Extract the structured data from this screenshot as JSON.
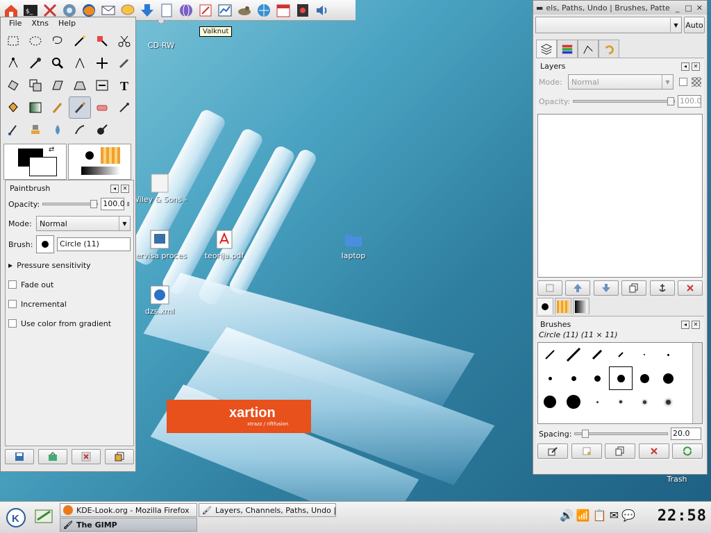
{
  "tooltip": "Valknut",
  "desktop_icons": [
    {
      "label": "CD-RW",
      "icon": "cdrom-icon"
    },
    {
      "label": "Wiley & Sons - The Art of So…",
      "icon": "document-icon"
    },
    {
      "label": "servisa procesu bloks…",
      "icon": "image-icon"
    },
    {
      "label": "teorija.pdf",
      "icon": "pdf-icon"
    },
    {
      "label": "laptop",
      "icon": "folder-icon"
    },
    {
      "label": "dzs.xml",
      "icon": "web-icon"
    },
    {
      "label": "Trash",
      "icon": "trash-icon"
    }
  ],
  "wallpaper": {
    "brand": "xartion",
    "sub": "xtrazz / riftfusion"
  },
  "toolbox": {
    "menu": [
      "File",
      "Xtns",
      "Help"
    ],
    "options_title": "Paintbrush",
    "opacity_label": "Opacity:",
    "opacity_value": "100.0",
    "mode_label": "Mode:",
    "mode_value": "Normal",
    "brush_label": "Brush:",
    "brush_value": "Circle (11)",
    "pressure_label": "Pressure sensitivity",
    "fade_label": "Fade out",
    "incremental_label": "Incremental",
    "gradient_label": "Use color from gradient"
  },
  "dock": {
    "title": "els, Paths, Undo | Brushes, Patte",
    "auto_label": "Auto",
    "layers_title": "Layers",
    "layers_mode_label": "Mode:",
    "layers_mode_value": "Normal",
    "layers_opacity_label": "Opacity:",
    "layers_opacity_value": "100.0",
    "brushes_title": "Brushes",
    "brush_info": "Circle (11) (11 × 11)",
    "spacing_label": "Spacing:",
    "spacing_value": "20.0"
  },
  "taskbar": {
    "tasks": [
      {
        "label": "KDE-Look.org - Mozilla Firefox"
      },
      {
        "label": "Layers, Channels, Paths, Undo | Bru"
      },
      {
        "label": "The GIMP"
      }
    ],
    "clock": "22:58"
  },
  "colors": {
    "accent_orange": "#e8501c",
    "selection": "#cfd6df"
  }
}
